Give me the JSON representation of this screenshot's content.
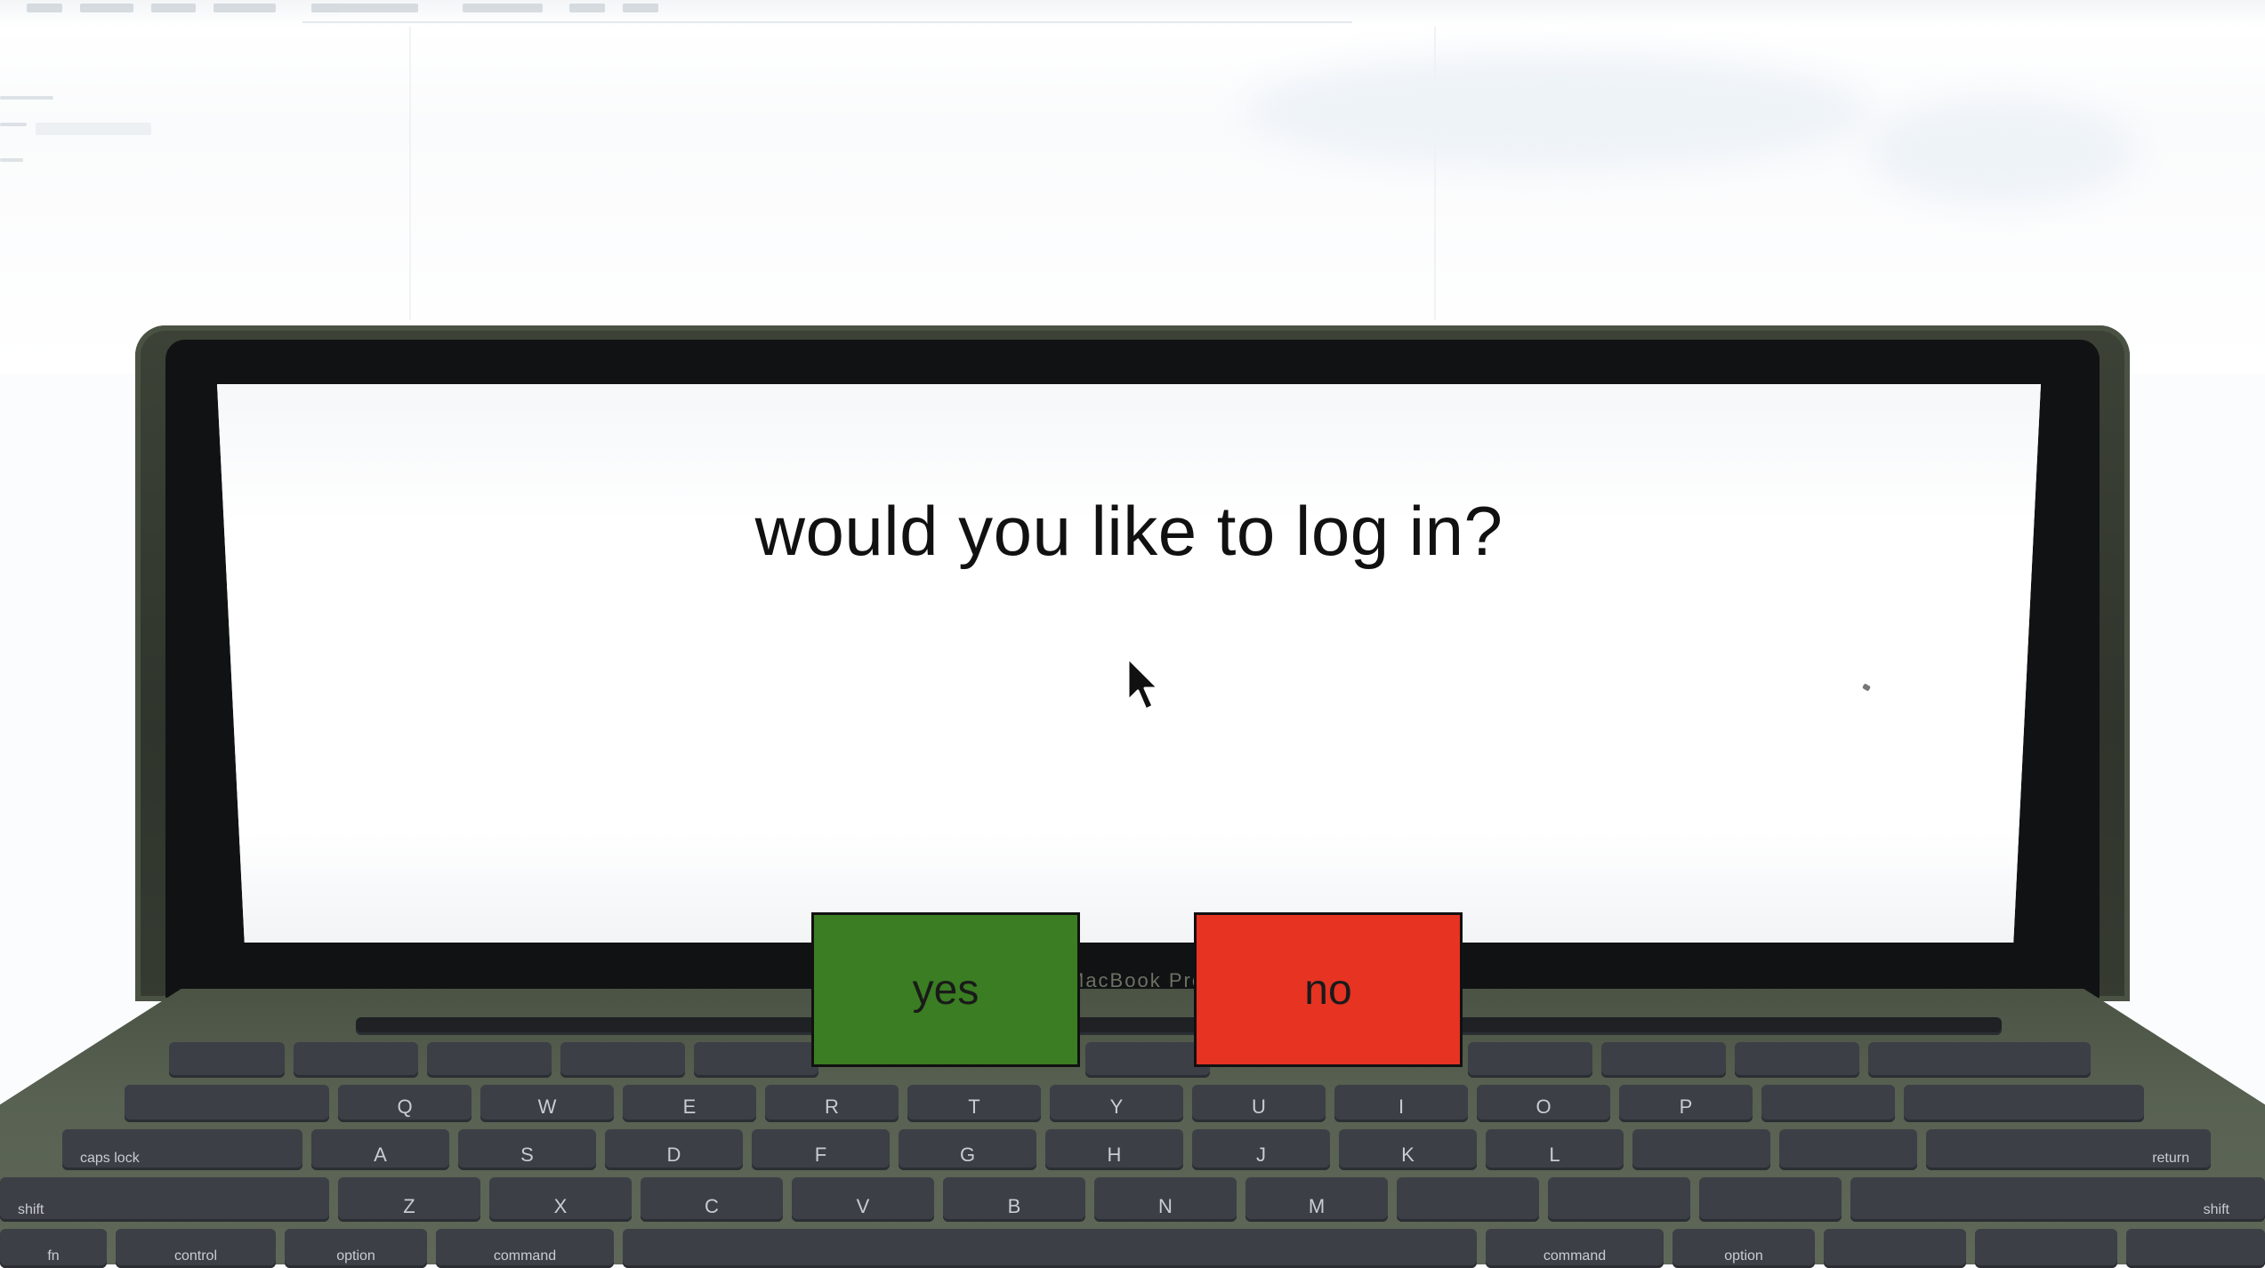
{
  "dialog": {
    "question": "would you like to log in?",
    "yes_label": "yes",
    "no_label": "no"
  },
  "laptop": {
    "brand": "MacBook Pro"
  },
  "keyboard": {
    "row1": [
      "Q",
      "W",
      "E",
      "R",
      "T",
      "Y",
      "U",
      "I",
      "O",
      "P"
    ],
    "row2": [
      "caps lock",
      "A",
      "S",
      "D",
      "F",
      "G",
      "H",
      "J",
      "K",
      "L",
      "return"
    ],
    "row3": [
      "shift",
      "Z",
      "X",
      "C",
      "V",
      "B",
      "N",
      "M",
      "shift"
    ],
    "row4": [
      "fn",
      "control",
      "option",
      "command",
      "command",
      "option"
    ]
  },
  "colors": {
    "yes": "#3a7d22",
    "no": "#e63322",
    "laptop_body": "#3c4236",
    "bezel": "#111214",
    "key": "#3c3f45"
  },
  "icons": {
    "cursor": "arrow-cursor-icon"
  }
}
